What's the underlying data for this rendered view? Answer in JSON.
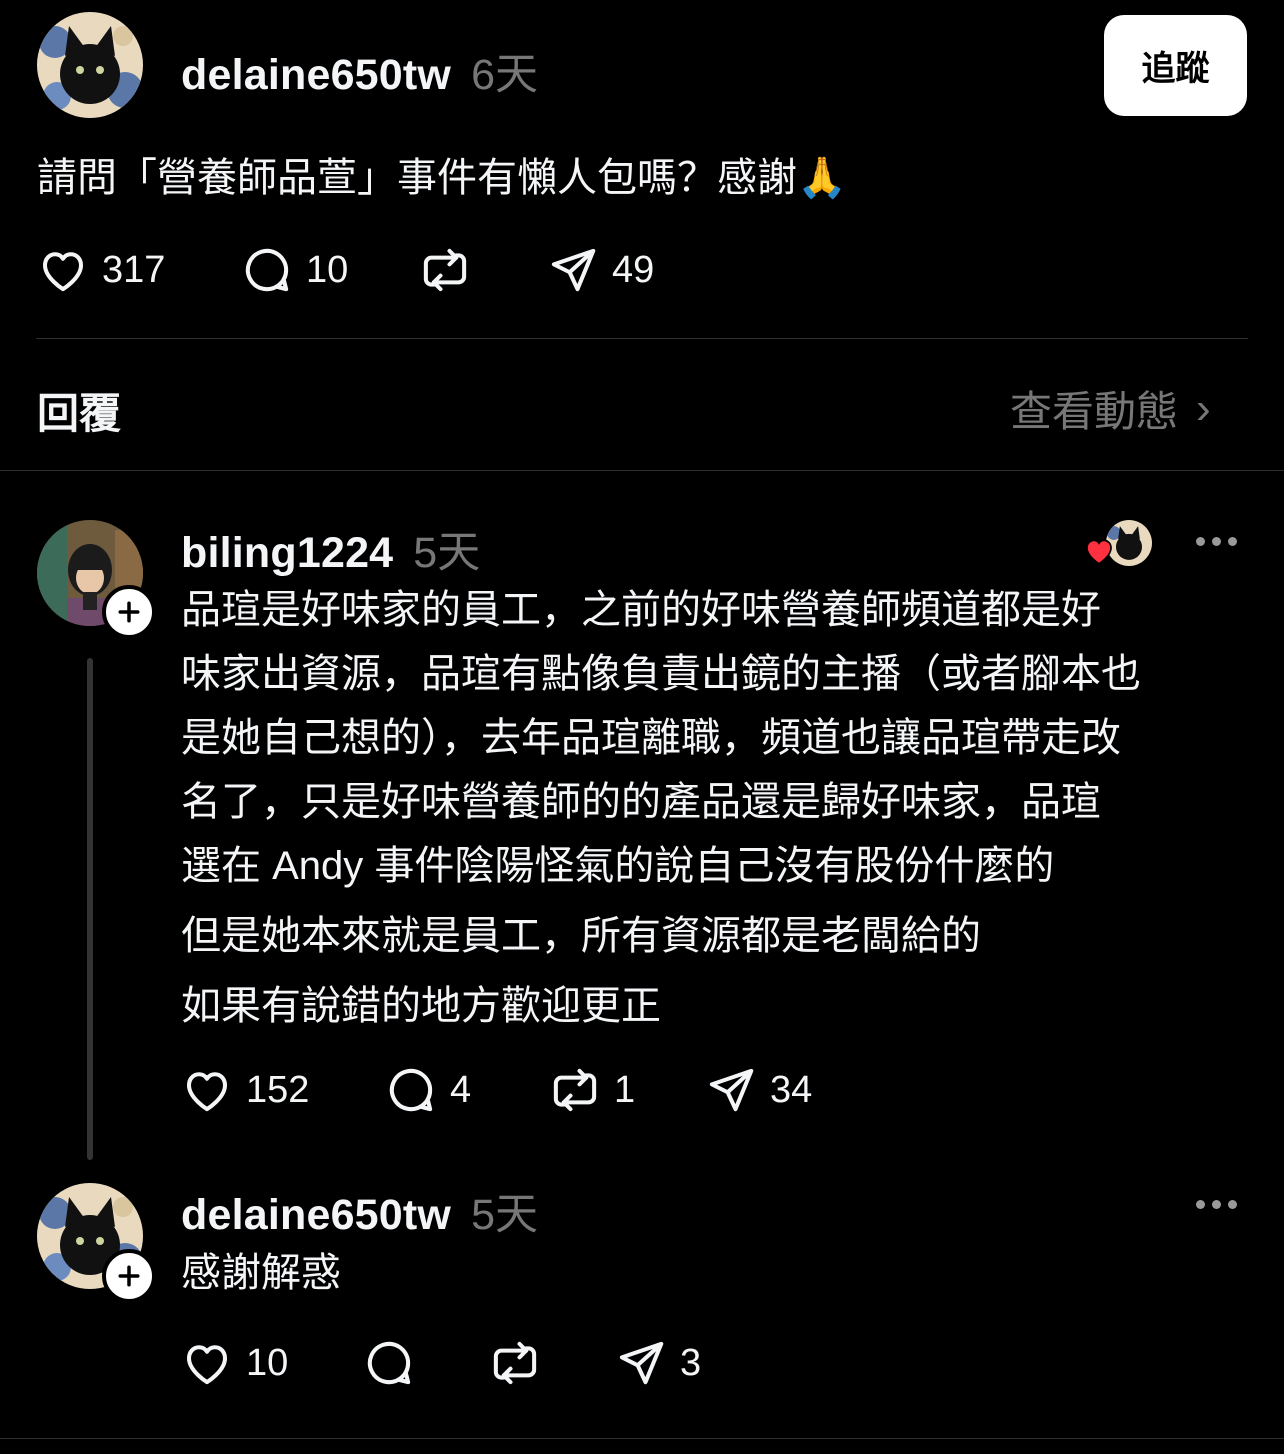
{
  "post": {
    "username": "delaine650tw",
    "time": "6天",
    "follow_label": "追蹤",
    "text": "請問「營養師品萱」事件有懶人包嗎？感謝🙏",
    "likes": "317",
    "comments": "10",
    "shares": "49"
  },
  "replies_header": {
    "title": "回覆",
    "view_activity": "查看動態",
    "chevron": "›"
  },
  "reply1": {
    "username": "biling1224",
    "time": "5天",
    "lines": [
      "品瑄是好味家的員工，之前的好味營養師頻道都是好",
      "味家出資源，品瑄有點像負責出鏡的主播（或者腳本也",
      "是她自己想的），去年品瑄離職，頻道也讓品瑄帶走改",
      "名了，只是好味營養師的的產品還是歸好味家，品瑄",
      "選在 Andy 事件陰陽怪氣的說自己沒有股份什麼的",
      "但是她本來就是員工，所有資源都是老闆給的",
      "如果有說錯的地方歡迎更正"
    ],
    "likes": "152",
    "comments": "4",
    "reposts": "1",
    "shares": "34"
  },
  "reply2": {
    "username": "delaine650tw",
    "time": "5天",
    "text": "感謝解惑",
    "likes": "10",
    "shares": "3"
  },
  "icons": {
    "like": "heart-icon",
    "comment": "comment-icon",
    "repost": "repost-icon",
    "share": "send-icon",
    "more": "more-icon",
    "liked_by_author": "heart-red-icon"
  },
  "colors": {
    "background": "#000000",
    "text": "#f3f5f7",
    "muted": "#777777",
    "heart_red": "#ff3040"
  }
}
